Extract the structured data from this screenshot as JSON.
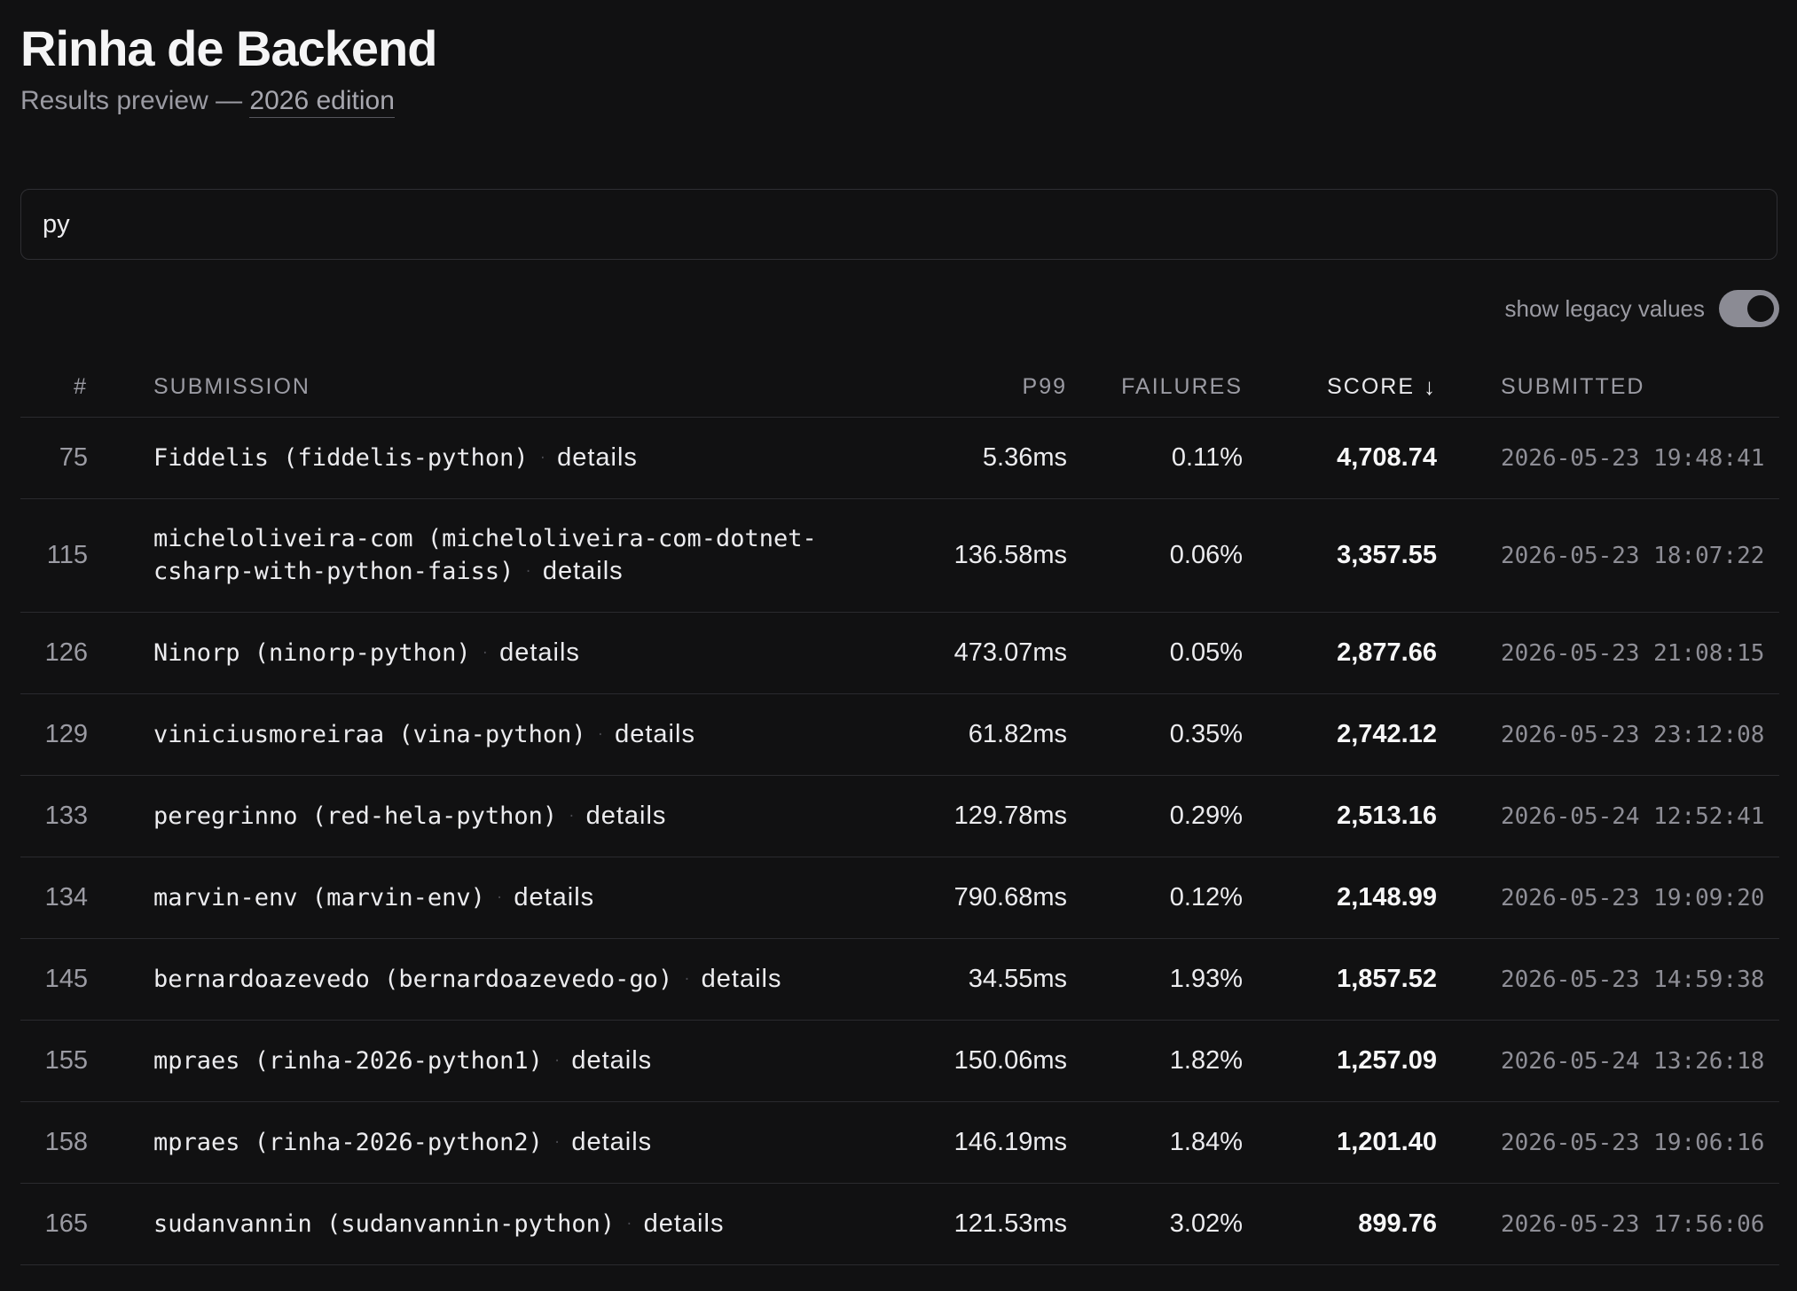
{
  "header": {
    "title": "Rinha de Backend",
    "subtitle_prefix": "Results preview — ",
    "edition_link": "2026 edition"
  },
  "search": {
    "value": "py"
  },
  "legacy_toggle": {
    "label": "show legacy values",
    "checked": true
  },
  "table": {
    "columns": {
      "rank": "#",
      "submission": "SUBMISSION",
      "p99": "P99",
      "failures": "FAILURES",
      "score": "SCORE",
      "submitted": "SUBMITTED"
    },
    "sort_indicator": "↓",
    "details_label": "details",
    "separator": "·",
    "rows": [
      {
        "rank": "75",
        "submission": "Fiddelis (fiddelis-python)",
        "p99": "5.36ms",
        "failures": "0.11%",
        "score": "4,708.74",
        "submitted": "2026-05-23 19:48:41"
      },
      {
        "rank": "115",
        "submission": "micheloliveira-com (micheloliveira-com-dotnet-csharp-with-python-faiss)",
        "p99": "136.58ms",
        "failures": "0.06%",
        "score": "3,357.55",
        "submitted": "2026-05-23 18:07:22"
      },
      {
        "rank": "126",
        "submission": "Ninorp (ninorp-python)",
        "p99": "473.07ms",
        "failures": "0.05%",
        "score": "2,877.66",
        "submitted": "2026-05-23 21:08:15"
      },
      {
        "rank": "129",
        "submission": "viniciusmoreiraa (vina-python)",
        "p99": "61.82ms",
        "failures": "0.35%",
        "score": "2,742.12",
        "submitted": "2026-05-23 23:12:08"
      },
      {
        "rank": "133",
        "submission": "peregrinno (red-hela-python)",
        "p99": "129.78ms",
        "failures": "0.29%",
        "score": "2,513.16",
        "submitted": "2026-05-24 12:52:41"
      },
      {
        "rank": "134",
        "submission": "marvin-env (marvin-env)",
        "p99": "790.68ms",
        "failures": "0.12%",
        "score": "2,148.99",
        "submitted": "2026-05-23 19:09:20"
      },
      {
        "rank": "145",
        "submission": "bernardoazevedo (bernardoazevedo-go)",
        "p99": "34.55ms",
        "failures": "1.93%",
        "score": "1,857.52",
        "submitted": "2026-05-23 14:59:38"
      },
      {
        "rank": "155",
        "submission": "mpraes (rinha-2026-python1)",
        "p99": "150.06ms",
        "failures": "1.82%",
        "score": "1,257.09",
        "submitted": "2026-05-24 13:26:18"
      },
      {
        "rank": "158",
        "submission": "mpraes (rinha-2026-python2)",
        "p99": "146.19ms",
        "failures": "1.84%",
        "score": "1,201.40",
        "submitted": "2026-05-23 19:06:16"
      },
      {
        "rank": "165",
        "submission": "sudanvannin (sudanvannin-python)",
        "p99": "121.53ms",
        "failures": "3.02%",
        "score": "899.76",
        "submitted": "2026-05-23 17:56:06"
      }
    ]
  }
}
